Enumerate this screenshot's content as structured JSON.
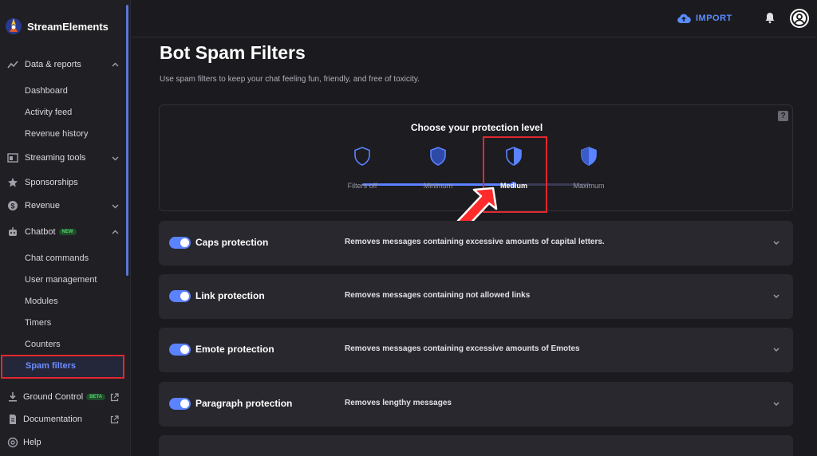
{
  "app": {
    "name": "StreamElements"
  },
  "sidebar": {
    "sections": [
      {
        "label": "Data & reports",
        "icon": "chart-line-icon",
        "chevron": "up"
      },
      {
        "label": "Streaming tools",
        "icon": "overlay-icon",
        "chevron": "down"
      },
      {
        "label": "Sponsorships",
        "icon": "star-icon"
      },
      {
        "label": "Revenue",
        "icon": "dollar-icon",
        "chevron": "down"
      },
      {
        "label": "Chatbot",
        "icon": "robot-icon",
        "chevron": "up",
        "badge": "NEW"
      },
      {
        "label": "Ground Control",
        "icon": "download-icon",
        "badge": "BETA",
        "external": true
      },
      {
        "label": "Documentation",
        "icon": "document-icon",
        "external": true
      },
      {
        "label": "Help",
        "icon": "help-circle-icon"
      }
    ],
    "data_items": [
      "Dashboard",
      "Activity feed",
      "Revenue history"
    ],
    "chatbot_items": [
      "Chat commands",
      "User management",
      "Modules",
      "Timers",
      "Counters",
      "Spam filters"
    ],
    "active_item": "Spam filters"
  },
  "topbar": {
    "import_label": "IMPORT"
  },
  "page": {
    "title": "Bot Spam Filters",
    "subtitle": "Use spam filters to keep your chat feeling fun, friendly, and free of toxicity."
  },
  "protection": {
    "title": "Choose your protection level",
    "help_label": "?",
    "options": [
      "Filters off",
      "Minimum",
      "Medium",
      "Maximum"
    ],
    "selected": "Medium",
    "level_fraction": 0.667
  },
  "filters": [
    {
      "name": "Caps protection",
      "description": "Removes messages containing excessive amounts of capital letters.",
      "enabled": true
    },
    {
      "name": "Link protection",
      "description": "Removes messages containing not allowed links",
      "enabled": true
    },
    {
      "name": "Emote protection",
      "description": "Removes messages containing excessive amounts of Emotes",
      "enabled": true
    },
    {
      "name": "Paragraph protection",
      "description": "Removes lengthy messages",
      "enabled": true
    }
  ],
  "colors": {
    "accent": "#5b82ff",
    "highlight": "#e2282e",
    "background": "#1b1b1f"
  }
}
